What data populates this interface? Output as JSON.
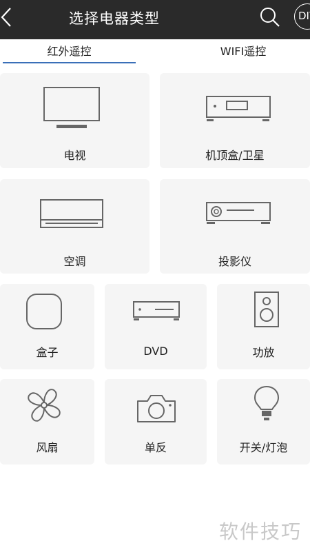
{
  "header": {
    "title": "选择电器类型",
    "diy_label": "DIY"
  },
  "tabs": [
    {
      "label": "红外遥控",
      "active": true
    },
    {
      "label": "WIFI遥控",
      "active": false
    }
  ],
  "devices": [
    {
      "label": "电视",
      "icon": "tv-icon"
    },
    {
      "label": "机顶盒/卫星",
      "icon": "set-top-box-icon"
    },
    {
      "label": "空调",
      "icon": "air-conditioner-icon"
    },
    {
      "label": "投影仪",
      "icon": "projector-icon"
    },
    {
      "label": "盒子",
      "icon": "box-icon"
    },
    {
      "label": "DVD",
      "icon": "dvd-player-icon"
    },
    {
      "label": "功放",
      "icon": "speaker-icon"
    },
    {
      "label": "风扇",
      "icon": "fan-icon"
    },
    {
      "label": "单反",
      "icon": "camera-icon"
    },
    {
      "label": "开关/灯泡",
      "icon": "light-bulb-icon"
    }
  ],
  "watermark": "软件技巧",
  "colors": {
    "header_bg": "#2a2a2a",
    "tab_underline": "#3a6fb8",
    "card_bg": "#f5f5f5",
    "icon_stroke": "#666666"
  }
}
